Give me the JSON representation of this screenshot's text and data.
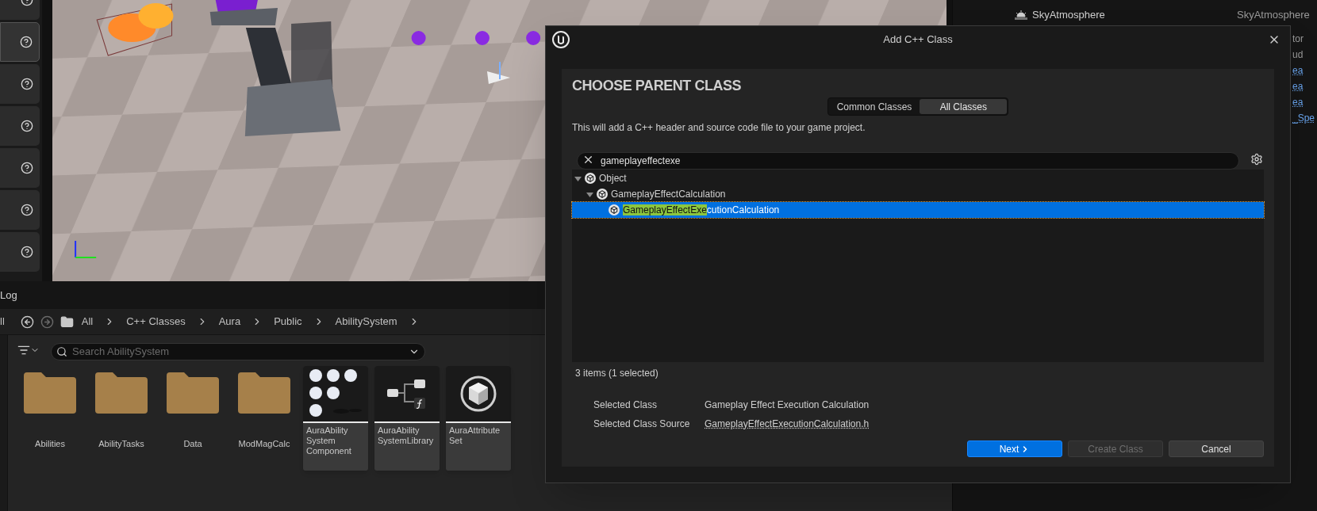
{
  "toolbar_buttons": [
    {
      "selected": false
    },
    {
      "selected": true
    },
    {
      "selected": false
    },
    {
      "selected": false
    },
    {
      "selected": false
    },
    {
      "selected": false
    },
    {
      "selected": false
    }
  ],
  "outliner": {
    "rows": [
      {
        "label": "SkyAtmosphere",
        "type": "SkyAtmosphere"
      }
    ]
  },
  "details_fragments": [
    {
      "text": "tor",
      "link": false
    },
    {
      "text": "ud",
      "link": false
    },
    {
      "text": "ea",
      "link": true
    },
    {
      "text": "ea",
      "link": true
    },
    {
      "text": "ea",
      "link": true
    },
    {
      "text": "_Spe",
      "link": true
    }
  ],
  "content_browser": {
    "tab": "Log",
    "breadcrumb_cut": "ll",
    "path": [
      "All",
      "C++ Classes",
      "Aura",
      "Public",
      "AbilitySystem"
    ],
    "search": {
      "placeholder": "Search AbilitySystem"
    },
    "items": [
      {
        "kind": "folder",
        "label": "Abilities"
      },
      {
        "kind": "folder",
        "label": "AbilityTasks"
      },
      {
        "kind": "folder",
        "label": "Data"
      },
      {
        "kind": "folder",
        "label": "ModMagCalc"
      },
      {
        "kind": "component",
        "label": "AuraAbility System Component"
      },
      {
        "kind": "library",
        "label": "AuraAbility SystemLibrary"
      },
      {
        "kind": "attribute_set",
        "label": "AuraAttribute Set"
      }
    ]
  },
  "dialog": {
    "title": "Add C++ Class",
    "heading": "CHOOSE PARENT CLASS",
    "tabs": [
      {
        "label": "Common Classes",
        "selected": false
      },
      {
        "label": "All Classes",
        "selected": true
      }
    ],
    "description": "This will add a C++ header and source code file to your game project.",
    "search": {
      "value": "gameplayeffectexe"
    },
    "tree": [
      {
        "label": "Object",
        "expanded": true,
        "selected": false,
        "children": [
          {
            "label": "GameplayEffectCalculation",
            "expanded": true,
            "selected": false,
            "children": [
              {
                "match": "GameplayEffectExe",
                "label": "cutionCalculation",
                "selected": true
              }
            ]
          }
        ]
      }
    ],
    "count": "3 items (1 selected)",
    "details": [
      {
        "label": "Selected Class",
        "value": "Gameplay Effect Execution Calculation",
        "link": false
      },
      {
        "label": "Selected Class Source",
        "value": "GameplayEffectExecutionCalculation.h",
        "link": true
      }
    ],
    "buttons": [
      {
        "label": "Next",
        "kind": "primary",
        "disabled": false
      },
      {
        "label": "Create Class",
        "kind": "normal",
        "disabled": true
      },
      {
        "label": "Cancel",
        "kind": "normal",
        "disabled": false
      }
    ]
  }
}
